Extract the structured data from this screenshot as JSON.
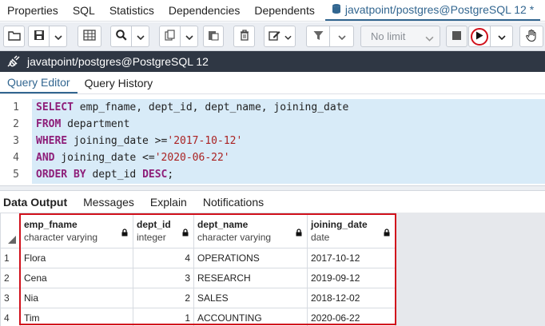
{
  "top_tabs": [
    {
      "label": "Properties"
    },
    {
      "label": "SQL"
    },
    {
      "label": "Statistics"
    },
    {
      "label": "Dependencies"
    },
    {
      "label": "Dependents"
    }
  ],
  "active_query_tab": {
    "label": "javatpoint/postgres@PostgreSQL 12 *"
  },
  "toolbar": {
    "row_limit": "No limit"
  },
  "connection": {
    "label": "javatpoint/postgres@PostgreSQL 12"
  },
  "query_tabs": [
    {
      "label": "Query Editor"
    },
    {
      "label": "Query History"
    }
  ],
  "editor": {
    "line_numbers": [
      "1",
      "2",
      "3",
      "4",
      "5"
    ],
    "line1": {
      "kw": "SELECT",
      "rest": " emp_fname, dept_id, dept_name, joining_date"
    },
    "line2": {
      "kw": "FROM",
      "rest": " department"
    },
    "line3": {
      "kw": "WHERE",
      "rest": " joining_date >=",
      "str": "'2017-10-12'"
    },
    "line4": {
      "kw": "AND",
      "rest": " joining_date <=",
      "str": "'2020-06-22'"
    },
    "line5": {
      "kw": "ORDER BY",
      "rest": " dept_id ",
      "kw2": "DESC",
      "end": ";"
    }
  },
  "output_tabs": [
    {
      "label": "Data Output"
    },
    {
      "label": "Messages"
    },
    {
      "label": "Explain"
    },
    {
      "label": "Notifications"
    }
  ],
  "grid": {
    "columns": [
      {
        "name": "emp_fname",
        "type": "character varying"
      },
      {
        "name": "dept_id",
        "type": "integer"
      },
      {
        "name": "dept_name",
        "type": "character varying"
      },
      {
        "name": "joining_date",
        "type": "date"
      }
    ],
    "rows": [
      {
        "num": "1",
        "emp_fname": "Flora",
        "dept_id": "4",
        "dept_name": "OPERATIONS",
        "joining_date": "2017-10-12"
      },
      {
        "num": "2",
        "emp_fname": "Cena",
        "dept_id": "3",
        "dept_name": "RESEARCH",
        "joining_date": "2019-09-12"
      },
      {
        "num": "3",
        "emp_fname": "Nia",
        "dept_id": "2",
        "dept_name": "SALES",
        "joining_date": "2018-12-02"
      },
      {
        "num": "4",
        "emp_fname": "Tim",
        "dept_id": "1",
        "dept_name": "ACCOUNTING",
        "joining_date": "2020-06-22"
      }
    ]
  },
  "colors": {
    "accent": "#326690",
    "keyword": "#8e1e79",
    "string": "#aa2222",
    "highlight": "#d1111c",
    "connbar": "#2f3744"
  }
}
